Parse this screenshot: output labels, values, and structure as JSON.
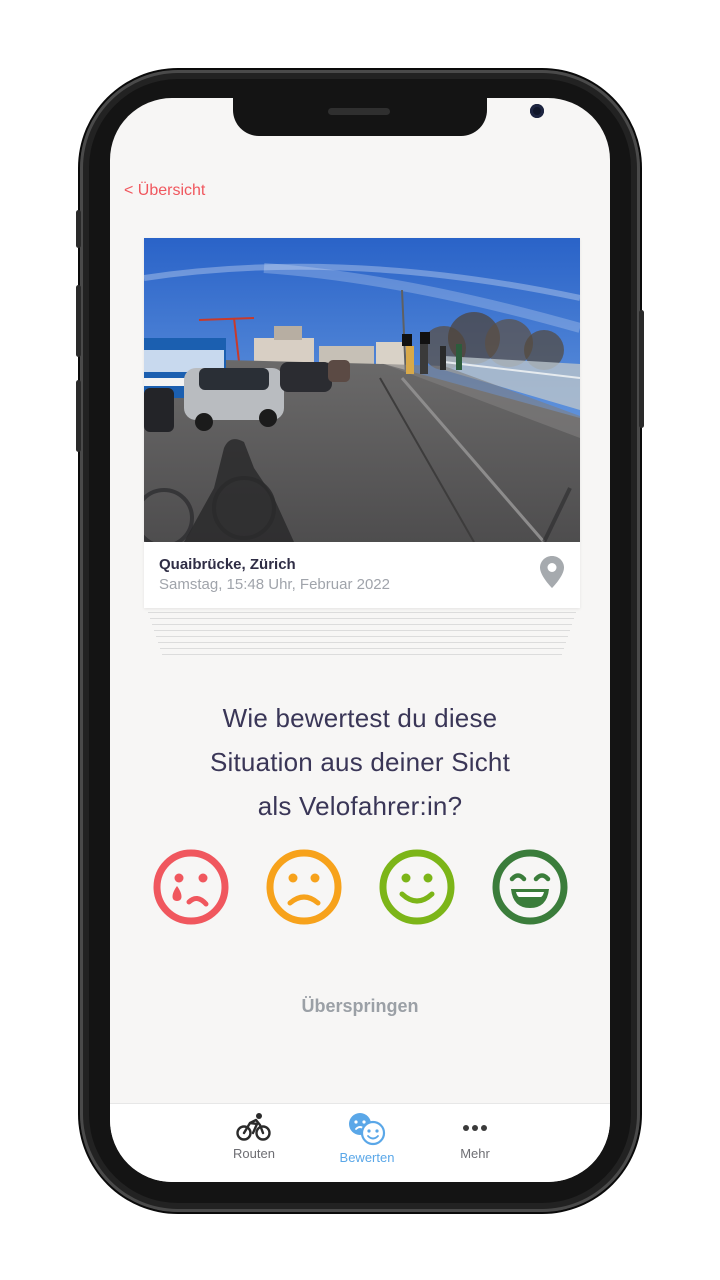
{
  "header": {
    "back_label": "< Übersicht"
  },
  "card": {
    "location": "Quaibrücke, Zürich",
    "datetime": "Samstag, 15:48 Uhr, Februar 2022",
    "pin_icon": "map-pin-icon"
  },
  "question": {
    "line1": "Wie bewertest du diese",
    "line2": "Situation aus deiner Sicht",
    "line3": "als Velofahrer:in?"
  },
  "ratings": [
    {
      "icon": "sad-tear-face-icon",
      "color": "#f0575e"
    },
    {
      "icon": "frown-face-icon",
      "color": "#f7a21b"
    },
    {
      "icon": "smile-face-icon",
      "color": "#7cb518"
    },
    {
      "icon": "grin-face-icon",
      "color": "#3b7d3b"
    }
  ],
  "skip_label": "Überspringen",
  "tabs": [
    {
      "label": "Routen",
      "icon": "bicycle-icon",
      "active": false
    },
    {
      "label": "Bewerten",
      "icon": "rating-faces-icon",
      "active": true
    },
    {
      "label": "Mehr",
      "icon": "more-dots-icon",
      "active": false
    }
  ],
  "colors": {
    "accent": "#f0575e",
    "tab_active": "#5aa7e8",
    "text_dark": "#3a3657"
  }
}
